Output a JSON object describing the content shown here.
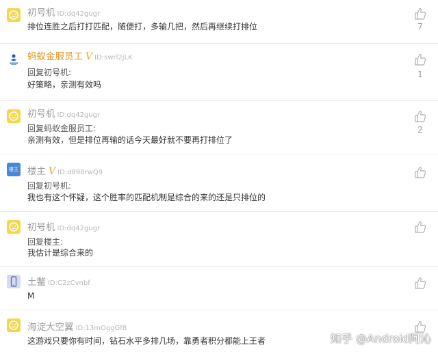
{
  "comments": [
    {
      "username": "初号机",
      "id": "ID:dq42gugr",
      "vip": false,
      "reply_to": "",
      "text": "排位连胜之后打打匹配，随便打，多输几把，然后再继续打排位",
      "likes": "7"
    },
    {
      "username": "蚂蚁金服员工",
      "id": "ID:swrl2jLK",
      "vip": true,
      "reply_to": "回复初号机:",
      "text": "好策略，亲测有效吗",
      "likes": "1"
    },
    {
      "username": "初号机",
      "id": "ID:dq42gugr",
      "vip": false,
      "reply_to": "回复蚂蚁金服员工:",
      "text": "亲测有效，但是排位再输的话今天最好就不要再打排位了",
      "likes": "2"
    },
    {
      "username": "楼主",
      "id": "ID:d898rwQ9",
      "vip": true,
      "reply_to": "回复初号机:",
      "text": "我也有这个怀疑，这个胜率的匹配机制是综合的来的还是只排位的",
      "likes": ""
    },
    {
      "username": "初号机",
      "id": "ID:dq42gugr",
      "vip": false,
      "reply_to": "回复楼主:",
      "text": "我估计是综合来的",
      "likes": ""
    },
    {
      "username": "土鳖",
      "id": "ID:C2zCvnbf",
      "vip": false,
      "reply_to": "",
      "text": "M",
      "likes": ""
    },
    {
      "username": "海淀大空翼",
      "id": "ID:13mOggGf8",
      "vip": false,
      "reply_to": "",
      "text": "这游戏只要你有时间，钻石水平多排几场，靠勇者积分都能上王者",
      "likes": ""
    }
  ],
  "vip_badge": "V",
  "host_avatar_label": "楼主",
  "watermark": "知乎 @Android阿沁",
  "colors": {
    "username": "#9a9a9a",
    "vip_username": "#e0961f",
    "divider": "#e9e9e9"
  }
}
